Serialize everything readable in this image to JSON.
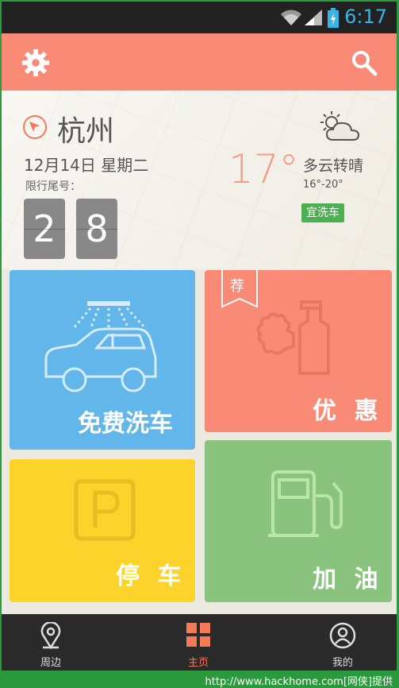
{
  "status": {
    "time": "6:17"
  },
  "weather": {
    "city": "杭州",
    "date": "12月14日  星期二",
    "limit_label": "限行尾号：",
    "limit_digits": [
      "2",
      "8"
    ],
    "temperature": "17°",
    "condition": "多云转晴",
    "range": "16°-20°",
    "wash_badge": "宜洗车"
  },
  "tiles": {
    "wash": "免费洗车",
    "deal": "优 惠",
    "deal_ribbon": "荐",
    "park": "停 车",
    "fuel": "加 油"
  },
  "nav": {
    "nearby": "周边",
    "home": "主页",
    "mine": "我的"
  },
  "footer": "http://www.hackhome.com[网侠]提供",
  "colors": {
    "toolbar": "#f88a76",
    "wash": "#62b6ea",
    "deal": "#f88a76",
    "park": "#fcd32b",
    "fuel": "#8ac37e",
    "nav_active": "#f47a58",
    "badge": "#4caf50"
  }
}
